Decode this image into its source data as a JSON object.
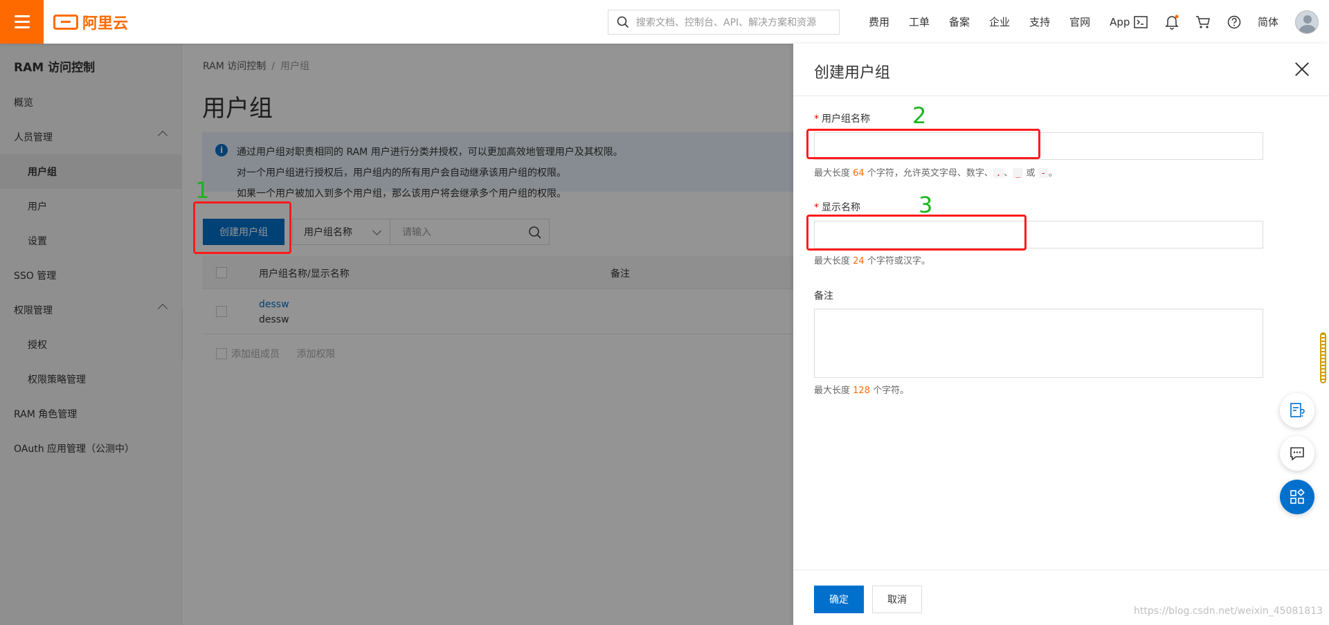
{
  "topbar": {
    "brand": "阿里云",
    "search_placeholder": "搜索文档、控制台、API、解决方案和资源",
    "links": [
      "费用",
      "工单",
      "备案",
      "企业",
      "支持",
      "官网",
      "App"
    ],
    "lang": "简体",
    "accent": "#ff6a00"
  },
  "sidebar": {
    "title": "RAM 访问控制",
    "items": [
      {
        "label": "概览"
      },
      {
        "label": "人员管理"
      },
      {
        "label": "用户组"
      },
      {
        "label": "用户"
      },
      {
        "label": "设置"
      },
      {
        "label": "SSO 管理"
      },
      {
        "label": "权限管理"
      },
      {
        "label": "授权"
      },
      {
        "label": "权限策略管理"
      },
      {
        "label": "RAM 角色管理"
      },
      {
        "label": "OAuth 应用管理（公测中）"
      }
    ]
  },
  "main": {
    "breadcrumb": [
      "RAM 访问控制",
      "用户组"
    ],
    "breadcrumb_sep": "/",
    "title": "用户组",
    "notice": [
      "通过用户组对职责相同的 RAM 用户进行分类并授权，可以更加高效地管理用户及其权限。",
      "对一个用户组进行授权后，用户组内的所有用户会自动继承该用户组的权限。",
      "如果一个用户被加入到多个用户组，那么该用户将会继承多个用户组的权限。"
    ],
    "create_button": "创建用户组",
    "filter_select": "用户组名称",
    "filter_placeholder": "请输入",
    "table": {
      "headers": [
        "用户组名称/显示名称",
        "备注"
      ],
      "rows": [
        {
          "name": "dessw",
          "display": "dessw"
        }
      ],
      "footer_actions": [
        "添加组成员",
        "添加权限"
      ]
    }
  },
  "drawer": {
    "title": "创建用户组",
    "fields": {
      "group_name": {
        "label": "用户组名称",
        "required_mark": "*",
        "help_prefix": "最大长度",
        "help_num": "64",
        "help_mid": "个字符，允许英文字母、数字、",
        "chars": [
          ".",
          "_",
          "-"
        ],
        "sep": "、",
        "or": "或",
        "end": "。"
      },
      "display_name": {
        "label": "显示名称",
        "required_mark": "*",
        "help_prefix": "最大长度",
        "help_num": "24",
        "help_suffix": "个字符或汉字。"
      },
      "remark": {
        "label": "备注",
        "help_prefix": "最大长度",
        "help_num": "128",
        "help_suffix": "个字符。"
      }
    },
    "ok": "确定",
    "cancel": "取消"
  },
  "annotations": {
    "n1": "1",
    "n2": "2",
    "n3": "3"
  },
  "watermark": "https://blog.csdn.net/weixin_45081813"
}
